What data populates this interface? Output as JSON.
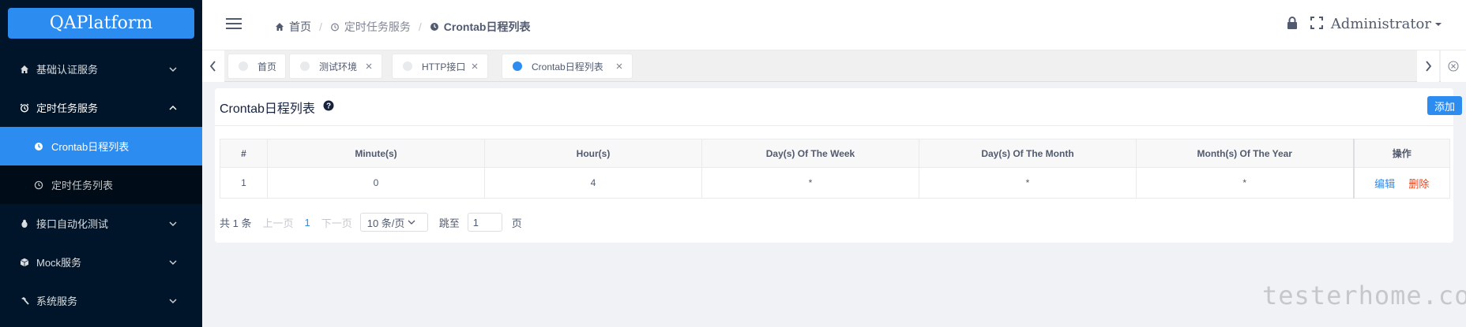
{
  "app": {
    "logo": "QAPlatform"
  },
  "sidebar": {
    "groups": [
      {
        "label": "基础认证服务",
        "icon": "home-icon"
      },
      {
        "label": "定时任务服务",
        "icon": "alarm-clock-icon"
      },
      {
        "label": "接口自动化测试",
        "icon": "bug-icon"
      },
      {
        "label": "Mock服务",
        "icon": "cube-icon"
      },
      {
        "label": "系统服务",
        "icon": "hammer-icon"
      }
    ],
    "sub": [
      {
        "label": "Crontab日程列表",
        "icon": "clock-icon"
      },
      {
        "label": "定时任务列表",
        "icon": "clock-icon"
      }
    ]
  },
  "header": {
    "breadcrumb": [
      "首页",
      "定时任务服务",
      "Crontab日程列表"
    ],
    "user": "Administrator"
  },
  "tabs": [
    {
      "label": "首页"
    },
    {
      "label": "测试环境"
    },
    {
      "label": "HTTP接口"
    },
    {
      "label": "Crontab日程列表"
    }
  ],
  "page": {
    "title": "Crontab日程列表",
    "add_label": "添加"
  },
  "table": {
    "headers": [
      "#",
      "Minute(s)",
      "Hour(s)",
      "Day(s) Of The Week",
      "Day(s) Of The Month",
      "Month(s) Of The Year",
      "操作"
    ],
    "rows": [
      {
        "id": "1",
        "minute": "0",
        "hour": "4",
        "dow": "*",
        "dom": "*",
        "moy": "*"
      }
    ],
    "edit_label": "编辑",
    "delete_label": "删除"
  },
  "pager": {
    "total": "共 1 条",
    "prev": "上一页",
    "current": "1",
    "next": "下一页",
    "size": "10 条/页",
    "jump": "跳至",
    "jump_value": "1",
    "unit": "页"
  },
  "watermark": "testerhome.com",
  "colors": {
    "primary": "#2d8cf0",
    "sidebar": "#001529",
    "danger": "#ed4014"
  }
}
